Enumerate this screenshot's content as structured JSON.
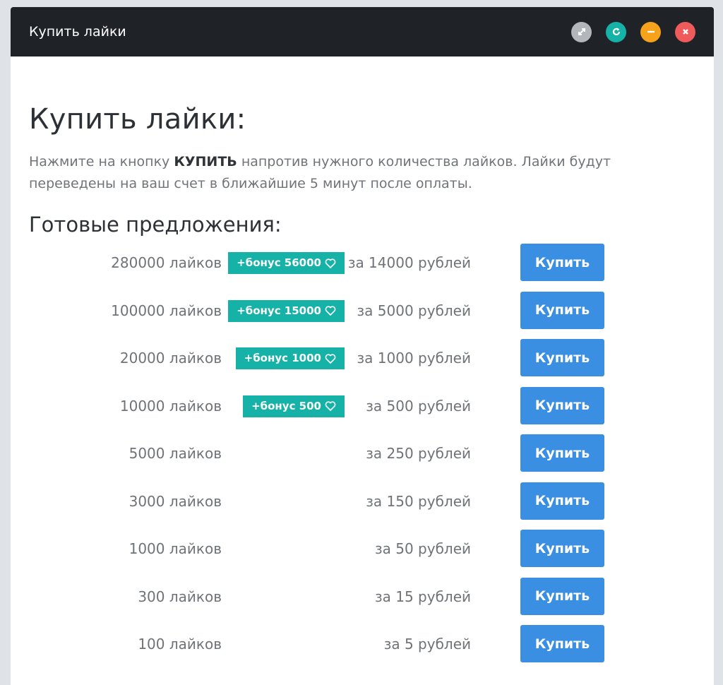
{
  "window": {
    "title": "Купить лайки"
  },
  "controls": {
    "expand": "expand-icon",
    "refresh": "refresh-icon",
    "minimize": "minimize-icon",
    "close": "close-icon"
  },
  "colors": {
    "titlebar_bg": "#1f2328",
    "accent_teal": "#16b2a7",
    "button_blue": "#3a8fe2",
    "minimize_orange": "#f7a21b",
    "close_red": "#ef5a5a"
  },
  "page": {
    "title": "Купить лайки:",
    "intro_before": "Нажмите на кнопку ",
    "intro_bold": "КУПИТЬ",
    "intro_after": " напротив нужного количества лайков. Лайки будут переведены на ваш счет в ближайшие 5 минут после оплаты.",
    "offers_heading": "Готовые предложения:"
  },
  "offers": [
    {
      "likes": "280000 лайков",
      "bonus": "+бонус 56000",
      "price": "за 14000 рублей",
      "button": "Купить"
    },
    {
      "likes": "100000 лайков",
      "bonus": "+бонус 15000",
      "price": "за 5000 рублей",
      "button": "Купить"
    },
    {
      "likes": "20000 лайков",
      "bonus": "+бонус 1000",
      "price": "за 1000 рублей",
      "button": "Купить"
    },
    {
      "likes": "10000 лайков",
      "bonus": "+бонус 500",
      "price": "за 500 рублей",
      "button": "Купить"
    },
    {
      "likes": "5000 лайков",
      "bonus": "",
      "price": "за 250 рублей",
      "button": "Купить"
    },
    {
      "likes": "3000 лайков",
      "bonus": "",
      "price": "за 150 рублей",
      "button": "Купить"
    },
    {
      "likes": "1000 лайков",
      "bonus": "",
      "price": "за 50 рублей",
      "button": "Купить"
    },
    {
      "likes": "300 лайков",
      "bonus": "",
      "price": "за 15 рублей",
      "button": "Купить"
    },
    {
      "likes": "100 лайков",
      "bonus": "",
      "price": "за 5 рублей",
      "button": "Купить"
    }
  ]
}
